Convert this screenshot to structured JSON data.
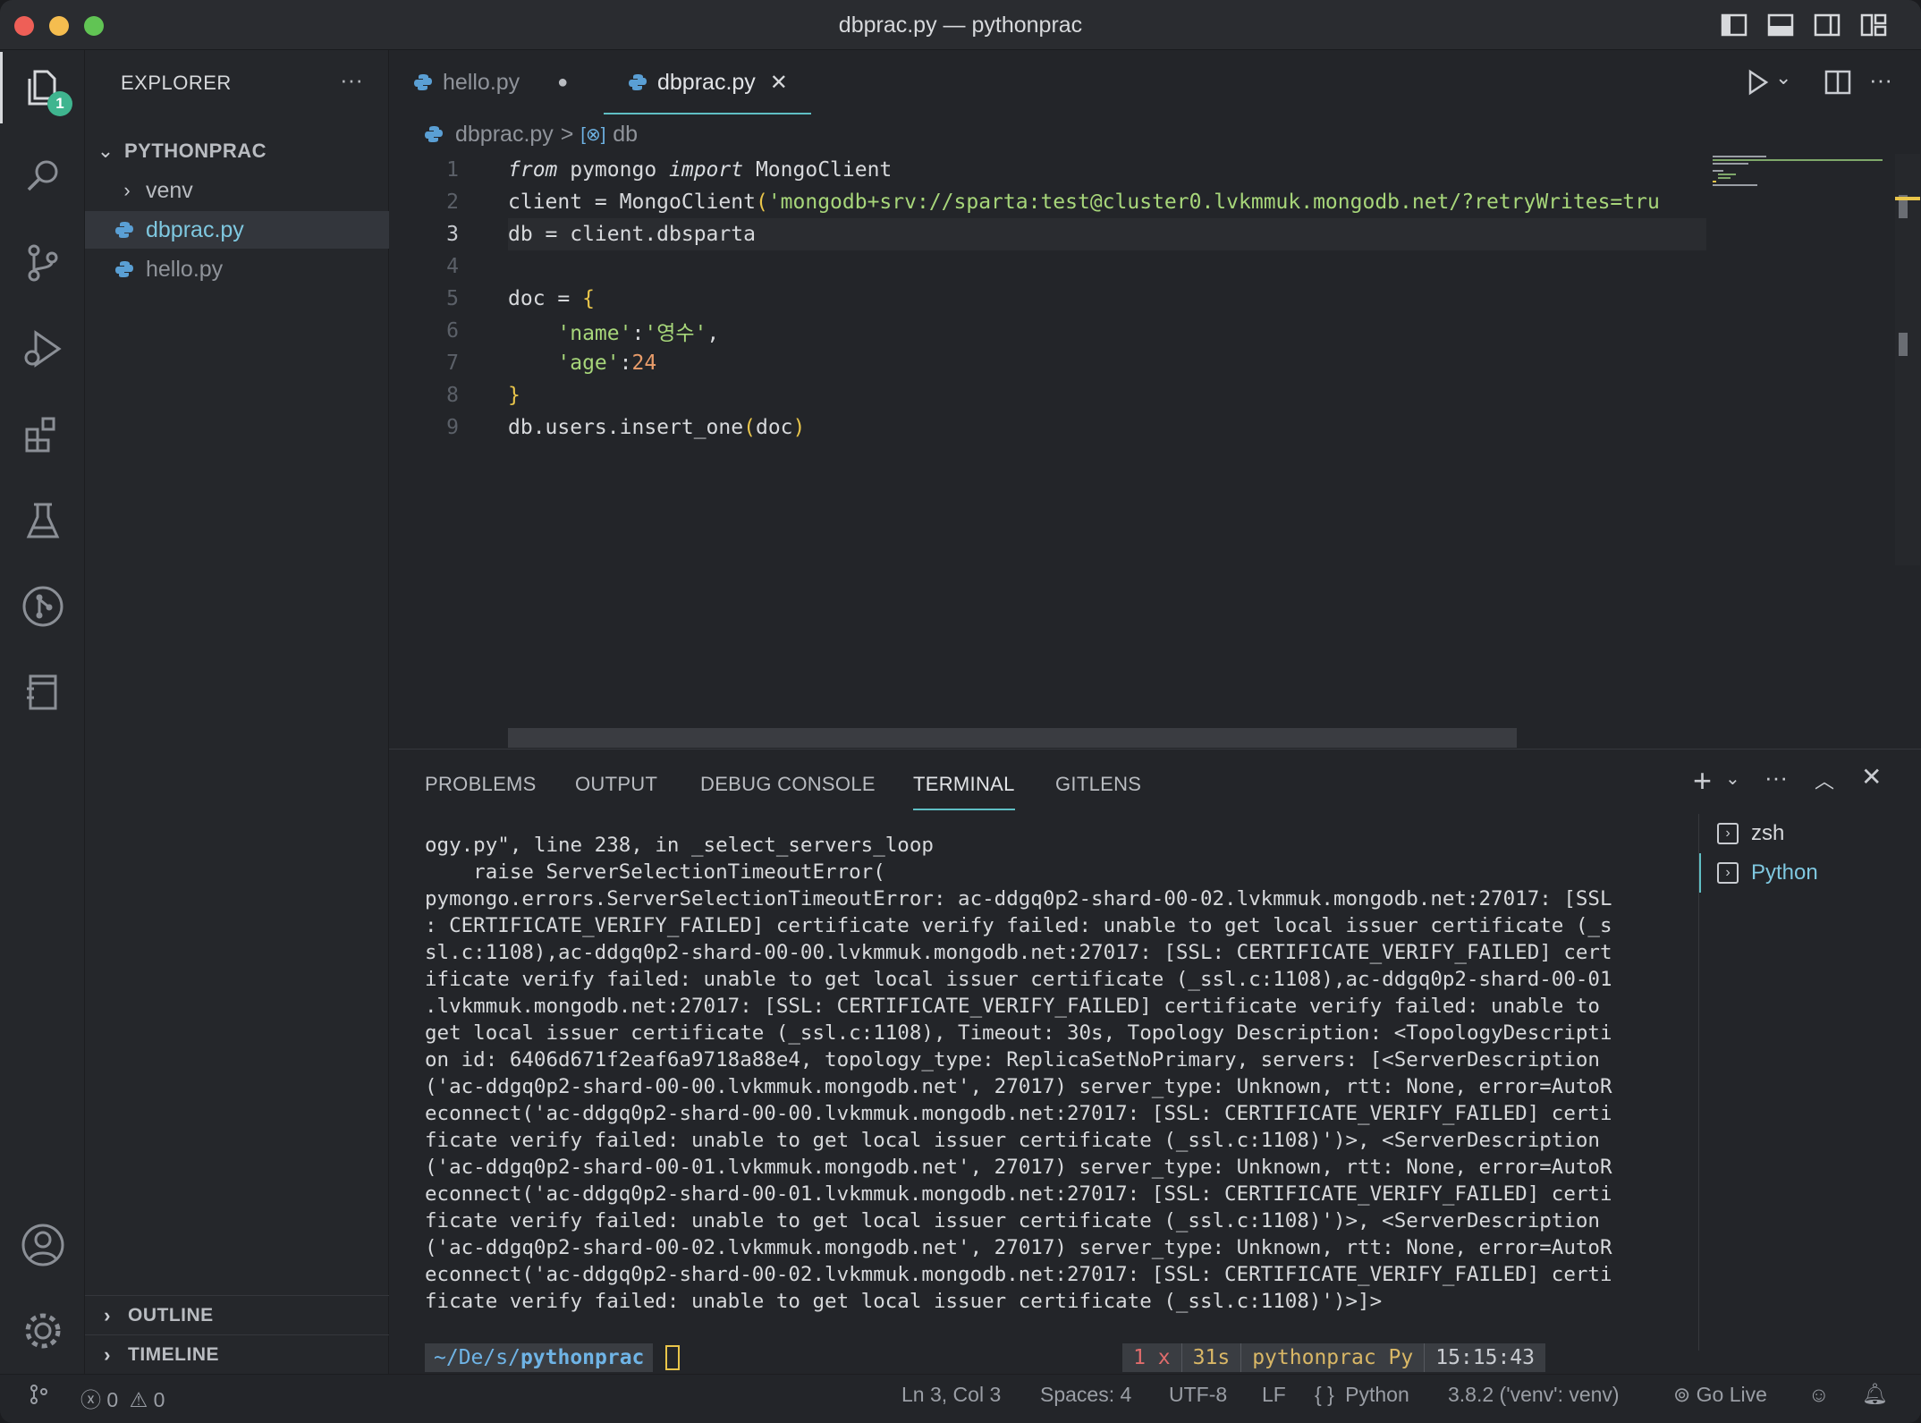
{
  "window": {
    "title": "dbprac.py — pythonprac",
    "colors": {
      "close": "#ee5f57",
      "minimize": "#f5bd4f",
      "maximize": "#61c454",
      "accent": "#5fbfc4",
      "badge": "#3fb58f"
    }
  },
  "activity_bar": {
    "explorer_badge": "1",
    "items": [
      "files-icon",
      "search-icon",
      "source-control-icon",
      "run-debug-icon",
      "extensions-icon",
      "testing-icon",
      "git-graph-icon",
      "notebook-icon",
      "account-icon",
      "settings-gear-icon"
    ]
  },
  "sidebar": {
    "title": "EXPLORER",
    "more": "···",
    "folder": "PYTHONPRAC",
    "items": [
      {
        "label": "venv",
        "type": "folder"
      },
      {
        "label": "dbprac.py",
        "type": "file"
      },
      {
        "label": "hello.py",
        "type": "file"
      }
    ],
    "outline": "OUTLINE",
    "timeline": "TIMELINE"
  },
  "tabs": [
    {
      "label": "hello.py",
      "state": "unsaved",
      "marker": "●"
    },
    {
      "label": "dbprac.py",
      "state": "active",
      "marker": "✕"
    }
  ],
  "breadcrumb": {
    "file": "dbprac.py",
    "sep": ">",
    "symbol": "db"
  },
  "editor": {
    "current_line": 3,
    "lines": [
      {
        "n": "1",
        "tokens": [
          {
            "t": "from",
            "c": "kw"
          },
          {
            "t": " pymongo ",
            "c": "plain"
          },
          {
            "t": "import",
            "c": "kw"
          },
          {
            "t": " MongoClient",
            "c": "plain"
          }
        ]
      },
      {
        "n": "2",
        "tokens": [
          {
            "t": "client = MongoClient",
            "c": "plain"
          },
          {
            "t": "(",
            "c": "brace"
          },
          {
            "t": "'mongodb+srv://sparta:test@cluster0.lvkmmuk.mongodb.net/?retryWrites=tru",
            "c": "str"
          }
        ]
      },
      {
        "n": "3",
        "tokens": [
          {
            "t": "db = client.dbsparta",
            "c": "plain"
          }
        ]
      },
      {
        "n": "4",
        "tokens": []
      },
      {
        "n": "5",
        "tokens": [
          {
            "t": "doc = ",
            "c": "plain"
          },
          {
            "t": "{",
            "c": "brace"
          }
        ]
      },
      {
        "n": "6",
        "tokens": [
          {
            "t": "    'name'",
            "c": "str"
          },
          {
            "t": ":",
            "c": "plain"
          },
          {
            "t": "'영수'",
            "c": "str"
          },
          {
            "t": ",",
            "c": "plain"
          }
        ]
      },
      {
        "n": "7",
        "tokens": [
          {
            "t": "    'age'",
            "c": "str"
          },
          {
            "t": ":",
            "c": "plain"
          },
          {
            "t": "24",
            "c": "num"
          }
        ]
      },
      {
        "n": "8",
        "tokens": [
          {
            "t": "}",
            "c": "brace"
          }
        ]
      },
      {
        "n": "9",
        "tokens": [
          {
            "t": "db.users.insert_one",
            "c": "plain"
          },
          {
            "t": "(",
            "c": "brace"
          },
          {
            "t": "doc",
            "c": "plain"
          },
          {
            "t": ")",
            "c": "brace"
          }
        ]
      }
    ]
  },
  "panel": {
    "tabs": [
      "PROBLEMS",
      "OUTPUT",
      "DEBUG CONSOLE",
      "TERMINAL",
      "GITLENS"
    ],
    "active_tab": "TERMINAL",
    "terminal_lines": [
      "ogy.py\", line 238, in _select_servers_loop",
      "    raise ServerSelectionTimeoutError(",
      "pymongo.errors.ServerSelectionTimeoutError: ac-ddgq0p2-shard-00-02.lvkmmuk.mongodb.net:27017: [SSL",
      ": CERTIFICATE_VERIFY_FAILED] certificate verify failed: unable to get local issuer certificate (_s",
      "sl.c:1108),ac-ddgq0p2-shard-00-00.lvkmmuk.mongodb.net:27017: [SSL: CERTIFICATE_VERIFY_FAILED] cert",
      "ificate verify failed: unable to get local issuer certificate (_ssl.c:1108),ac-ddgq0p2-shard-00-01",
      ".lvkmmuk.mongodb.net:27017: [SSL: CERTIFICATE_VERIFY_FAILED] certificate verify failed: unable to",
      "get local issuer certificate (_ssl.c:1108), Timeout: 30s, Topology Description: <TopologyDescripti",
      "on id: 6406d671f2eaf6a9718a88e4, topology_type: ReplicaSetNoPrimary, servers: [<ServerDescription",
      "('ac-ddgq0p2-shard-00-00.lvkmmuk.mongodb.net', 27017) server_type: Unknown, rtt: None, error=AutoR",
      "econnect('ac-ddgq0p2-shard-00-00.lvkmmuk.mongodb.net:27017: [SSL: CERTIFICATE_VERIFY_FAILED] certi",
      "ficate verify failed: unable to get local issuer certificate (_ssl.c:1108)')>, <ServerDescription",
      "('ac-ddgq0p2-shard-00-01.lvkmmuk.mongodb.net', 27017) server_type: Unknown, rtt: None, error=AutoR",
      "econnect('ac-ddgq0p2-shard-00-01.lvkmmuk.mongodb.net:27017: [SSL: CERTIFICATE_VERIFY_FAILED] certi",
      "ficate verify failed: unable to get local issuer certificate (_ssl.c:1108)')>, <ServerDescription",
      "('ac-ddgq0p2-shard-00-02.lvkmmuk.mongodb.net', 27017) server_type: Unknown, rtt: None, error=AutoR",
      "econnect('ac-ddgq0p2-shard-00-02.lvkmmuk.mongodb.net:27017: [SSL: CERTIFICATE_VERIFY_FAILED] certi",
      "ficate verify failed: unable to get local issuer certificate (_ssl.c:1108)')>]>"
    ],
    "prompt": {
      "path_prefix": "~/De/s/",
      "path_dir": "pythonprac"
    },
    "prompt_status": {
      "exit": "1 x",
      "duration": "31s",
      "env": "pythonprac Py",
      "time": "15:15:43"
    },
    "terminals": [
      "zsh",
      "Python"
    ],
    "active_terminal": "Python"
  },
  "statusbar": {
    "errors": "0",
    "warnings": "0",
    "position": "Ln 3, Col 3",
    "spaces": "Spaces: 4",
    "encoding": "UTF-8",
    "eol": "LF",
    "language": "Python",
    "interpreter": "3.8.2 ('venv': venv)",
    "golive": "Go Live"
  }
}
